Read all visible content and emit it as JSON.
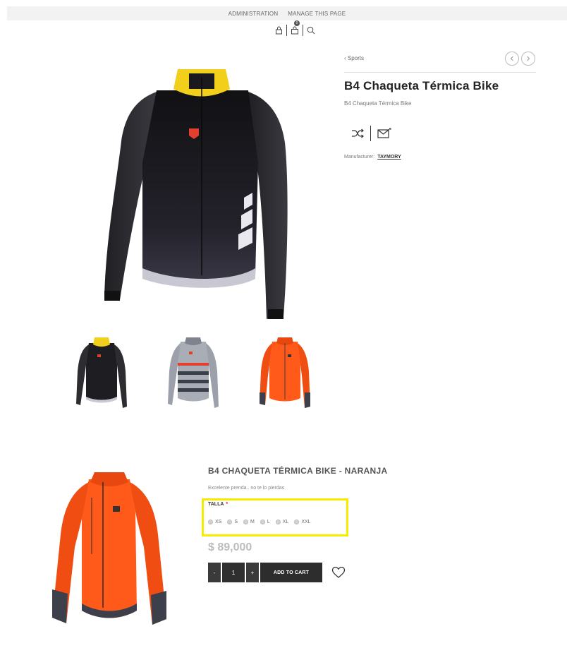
{
  "admin_bar": {
    "administration": "ADMINISTRATION",
    "manage": "MANAGE THIS PAGE"
  },
  "header": {
    "cart_count": "0",
    "icons": [
      "lock-icon",
      "cart-icon",
      "search-icon"
    ]
  },
  "breadcrumb": {
    "label": "‹ Sports"
  },
  "product": {
    "title": "B4 Chaqueta Térmica Bike",
    "subtitle": "B4 Chaqueta Térmica Bike",
    "manufacturer_label": "Manufacturer:",
    "manufacturer": "TAYMORY",
    "thumbnails": [
      "black-jacket",
      "grey-jacket",
      "orange-jacket"
    ]
  },
  "variant": {
    "title": "B4 CHAQUETA TÉRMICA BIKE - NARANJA",
    "description": "Excelente prenda.. no te lo pierdas",
    "size_label": "TALLA",
    "required_mark": "*",
    "sizes": [
      "XS",
      "S",
      "M",
      "L",
      "XL",
      "XXL"
    ],
    "price": "$ 89,000",
    "quantity": "1",
    "minus_label": "-",
    "plus_label": "+",
    "add_to_cart": "ADD TO CART"
  },
  "colors": {
    "highlight": "#f5ec00",
    "jacket_black": "#1e1e22",
    "jacket_orange": "#ff5a1a",
    "collar_yellow": "#f2cf1a",
    "logo_red": "#e2402f"
  }
}
